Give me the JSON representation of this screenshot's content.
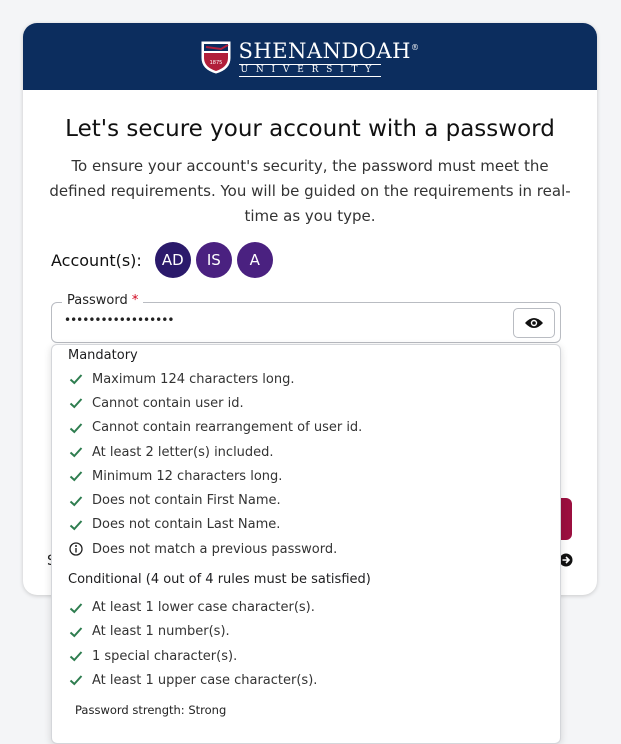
{
  "brand": {
    "name": "SHENANDOAH",
    "registered": "®",
    "sub": "UNIVERSITY",
    "shield_year": "1875"
  },
  "page": {
    "title": "Let's secure your account with a password",
    "lead": "To ensure your account's security, the password must meet the defined requirements. You will be guided on the requirements in real-time as you type."
  },
  "accounts": {
    "label": "Account(s):",
    "items": [
      {
        "initials": "AD",
        "color": "#2b1a6b"
      },
      {
        "initials": "IS",
        "color": "#4a2180"
      },
      {
        "initials": "A",
        "color": "#4a2180"
      }
    ]
  },
  "password": {
    "label": "Password",
    "required_mark": "*",
    "value": "••••••••••••••••••",
    "toggle_icon": "eye-icon"
  },
  "peek": {
    "s_text": "S"
  },
  "requirements": {
    "mandatory_title": "Mandatory",
    "mandatory": [
      {
        "text": "Maximum 124 characters long.",
        "status": "met"
      },
      {
        "text": "Cannot contain user id.",
        "status": "met"
      },
      {
        "text": "Cannot contain rearrangement of user id.",
        "status": "met"
      },
      {
        "text": "At least 2 letter(s) included.",
        "status": "met"
      },
      {
        "text": "Minimum 12 characters long.",
        "status": "met"
      },
      {
        "text": "Does not contain First Name.",
        "status": "met"
      },
      {
        "text": "Does not contain Last Name.",
        "status": "met"
      },
      {
        "text": "Does not match a previous password.",
        "status": "info"
      }
    ],
    "conditional_title": "Conditional (4 out of 4 rules must be satisfied)",
    "conditional": [
      {
        "text": "At least 1 lower case character(s).",
        "status": "met"
      },
      {
        "text": "At least 1 number(s).",
        "status": "met"
      },
      {
        "text": "1 special character(s).",
        "status": "met"
      },
      {
        "text": "At least 1 upper case character(s).",
        "status": "met"
      }
    ],
    "strength_label": "Password strength: Strong"
  },
  "colors": {
    "navy": "#0c2d5e",
    "check": "#2e7d4f",
    "crimson": "#9b0f3f"
  }
}
